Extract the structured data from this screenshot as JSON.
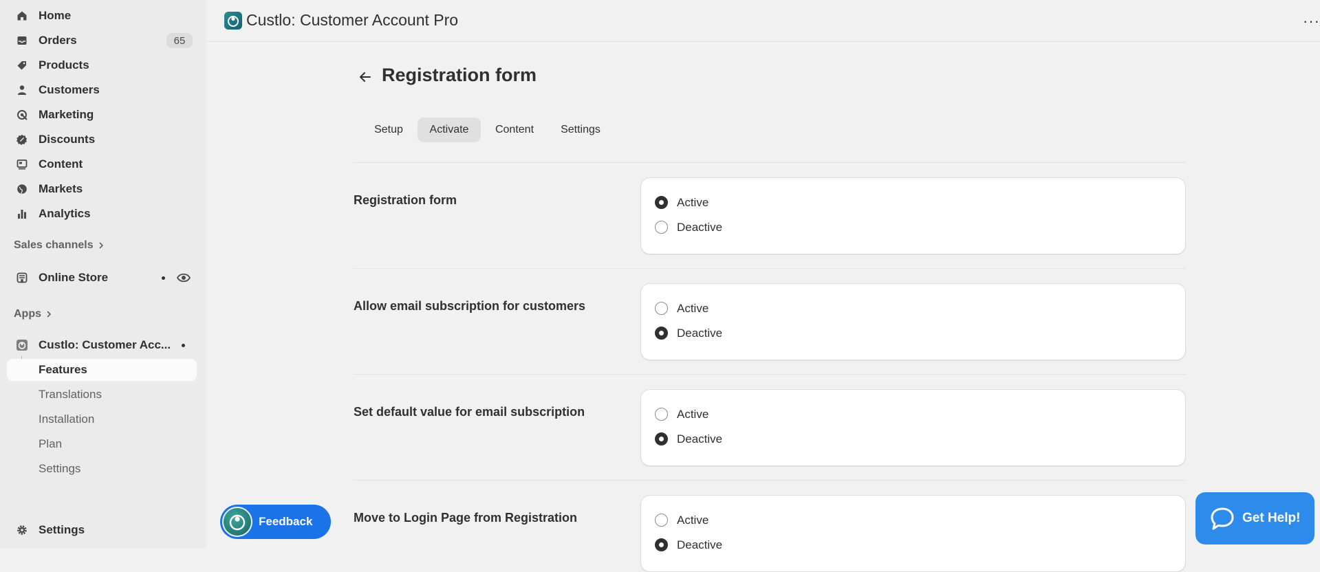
{
  "sidebar": {
    "main_items": [
      {
        "label": "Home"
      },
      {
        "label": "Orders",
        "badge": "65"
      },
      {
        "label": "Products"
      },
      {
        "label": "Customers"
      },
      {
        "label": "Marketing"
      },
      {
        "label": "Discounts"
      },
      {
        "label": "Content"
      },
      {
        "label": "Markets"
      },
      {
        "label": "Analytics"
      }
    ],
    "sales_channels_label": "Sales channels",
    "online_store_label": "Online Store",
    "apps_label": "Apps",
    "app_name": "Custlo: Customer Acc...",
    "app_subitems": [
      "Features",
      "Translations",
      "Installation",
      "Plan",
      "Settings"
    ],
    "settings_label": "Settings"
  },
  "header": {
    "app_title": "Custlo: Customer Account Pro",
    "more_label": "···"
  },
  "page": {
    "title": "Registration form",
    "tabs": [
      "Setup",
      "Activate",
      "Content",
      "Settings"
    ],
    "active_tab": "Activate"
  },
  "option_labels": {
    "active": "Active",
    "deactive": "Deactive"
  },
  "rows": [
    {
      "label": "Registration form",
      "selected": "Active"
    },
    {
      "label": "Allow email subscription for customers",
      "selected": "Deactive"
    },
    {
      "label": "Set default value for email subscription",
      "selected": "Deactive"
    },
    {
      "label": "Move to Login Page from Registration",
      "selected": "Deactive"
    }
  ],
  "feedback_label": "Feedback",
  "help_label": "Get Help!",
  "colors": {
    "sidebar_bg": "#ebebeb",
    "page_bg": "#f1f1f1",
    "feedback_blue": "#1a73e8",
    "help_blue": "#2d8ceb",
    "text": "#303030"
  }
}
